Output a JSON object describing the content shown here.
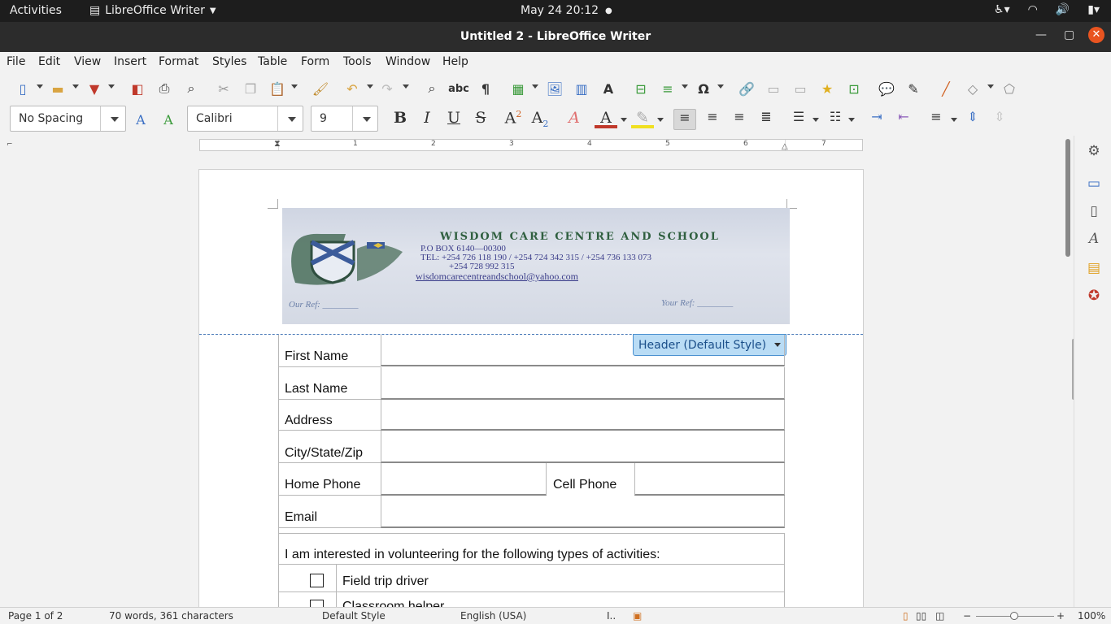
{
  "topbar": {
    "activities": "Activities",
    "app_name": "LibreOffice Writer",
    "clock": "May 24  20:12"
  },
  "window": {
    "title": "Untitled 2 - LibreOffice Writer"
  },
  "menu": [
    "File",
    "Edit",
    "View",
    "Insert",
    "Format",
    "Styles",
    "Table",
    "Form",
    "Tools",
    "Window",
    "Help"
  ],
  "formatting": {
    "paragraph_style": "No Spacing",
    "font_name": "Calibri",
    "font_size": "9"
  },
  "ruler": {
    "numbers": [
      "1",
      "2",
      "3",
      "4",
      "5",
      "6",
      "7"
    ]
  },
  "letterhead": {
    "school_name": "WISDOM CARE CENTRE AND SCHOOL",
    "pobox": "P.O BOX 6140—00300",
    "tel": "TEL: +254 726 118 190 / +254 724  342 315 / +254 736 133 073",
    "tel2": "+254 728 992 315",
    "email": "wisdomcarecentreandschool@yahoo.com",
    "our_ref": "Our Ref: ________",
    "your_ref": "Your Ref: ________"
  },
  "header_tag": "Header (Default Style)",
  "form": {
    "first_name": "First Name",
    "last_name": "Last Name",
    "address": "Address",
    "city_state_zip": "City/State/Zip",
    "home_phone": "Home Phone",
    "cell_phone": "Cell Phone",
    "email": "Email",
    "interest_text": "I am interested in volunteering for the following types of activities:",
    "activity1": "Field trip driver",
    "activity2": "Classroom helper"
  },
  "status": {
    "page": "Page 1 of 2",
    "words": "70 words, 361 characters",
    "page_style": "Default Style",
    "language": "English (USA)",
    "zoom": "100%"
  }
}
